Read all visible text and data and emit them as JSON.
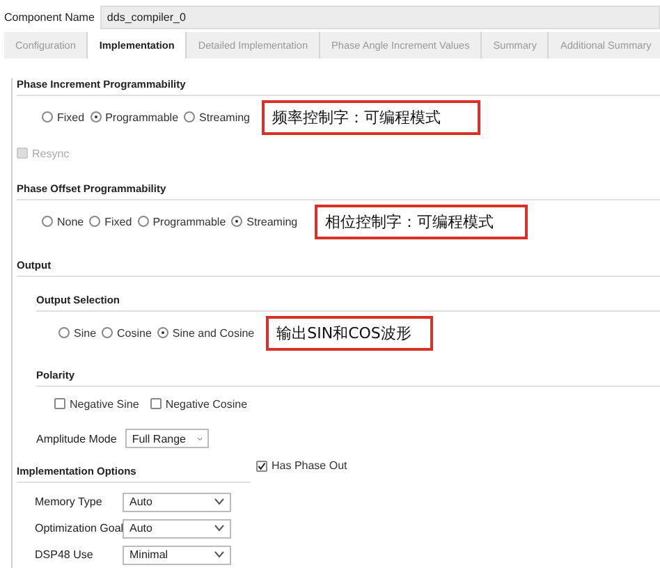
{
  "component_name": {
    "label": "Component Name",
    "value": "dds_compiler_0"
  },
  "tabs": [
    {
      "label": "Configuration",
      "selected": false
    },
    {
      "label": "Implementation",
      "selected": true
    },
    {
      "label": "Detailed Implementation",
      "selected": false
    },
    {
      "label": "Phase Angle Increment Values",
      "selected": false
    },
    {
      "label": "Summary",
      "selected": false
    },
    {
      "label": "Additional Summary",
      "selected": false
    }
  ],
  "phase_increment": {
    "heading": "Phase Increment Programmability",
    "options": [
      {
        "label": "Fixed",
        "selected": false
      },
      {
        "label": "Programmable",
        "selected": true
      },
      {
        "label": "Streaming",
        "selected": false
      }
    ],
    "annotation": "频率控制字：可编程模式",
    "resync": {
      "label": "Resync",
      "checked": false,
      "disabled": true
    }
  },
  "phase_offset": {
    "heading": "Phase Offset Programmability",
    "options": [
      {
        "label": "None",
        "selected": false
      },
      {
        "label": "Fixed",
        "selected": false
      },
      {
        "label": "Programmable",
        "selected": false
      },
      {
        "label": "Streaming",
        "selected": true
      }
    ],
    "annotation": "相位控制字：可编程模式"
  },
  "output": {
    "heading": "Output",
    "selection_heading": "Output Selection",
    "options": [
      {
        "label": "Sine",
        "selected": false
      },
      {
        "label": "Cosine",
        "selected": false
      },
      {
        "label": "Sine and Cosine",
        "selected": true
      }
    ],
    "annotation": "输出SIN和COS波形",
    "polarity_heading": "Polarity",
    "polarity": [
      {
        "label": "Negative Sine",
        "checked": false
      },
      {
        "label": "Negative Cosine",
        "checked": false
      }
    ],
    "amplitude_mode": {
      "label": "Amplitude Mode",
      "value": "Full Range"
    }
  },
  "implementation_options": {
    "heading": "Implementation Options",
    "fields": [
      {
        "label": "Memory Type",
        "value": "Auto"
      },
      {
        "label": "Optimization Goal",
        "value": "Auto"
      },
      {
        "label": "DSP48 Use",
        "value": "Minimal"
      }
    ]
  },
  "has_phase_out": {
    "label": "Has Phase Out",
    "checked": true
  }
}
